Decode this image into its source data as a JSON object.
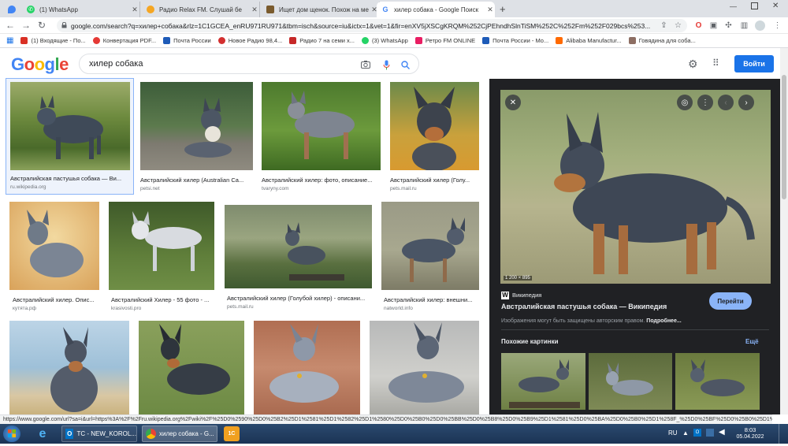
{
  "colors": {
    "accent": "#1a73e8",
    "panel_bg": "#202124",
    "link_blue": "#8ab4f8"
  },
  "tabs": [
    {
      "label": "",
      "icon": "maps-pin-icon",
      "color": "#4285f4"
    },
    {
      "label": "(1) WhatsApp",
      "icon": "whatsapp-icon",
      "color": "#25d366"
    },
    {
      "label": "Радио Relax FM. Слушай бе",
      "icon": "radio-icon",
      "color": "#f5a623"
    },
    {
      "label": "Ищет дом щенок. Похож на ме",
      "icon": "dog-icon",
      "color": "#7a5b2e"
    },
    {
      "label": "хилер собака - Google Поиск",
      "icon": "google-icon",
      "color": "#4285f4"
    }
  ],
  "toolbar": {
    "url": "google.com/search?q=хилер+собака&rlz=1C1GCEA_enRU971RU971&tbm=isch&source=iu&ictx=1&vet=1&fir=enXV5jXSCgKRQM%252CjPEhndhSlnTiSM%252C%252Fm%252F029bcs%253..."
  },
  "bookmarks": [
    {
      "label": "(1) Входящие - По...",
      "color": "#d93025"
    },
    {
      "label": "Конвертация PDF...",
      "color": "#e53935"
    },
    {
      "label": "Почта России",
      "color": "#1e5bb8"
    },
    {
      "label": "Новое Радио 98,4...",
      "color": "#d32f2f"
    },
    {
      "label": "Радио 7 на семи х...",
      "color": "#c62828"
    },
    {
      "label": "(3) WhatsApp",
      "color": "#25d366"
    },
    {
      "label": "Ретро FM ONLINE",
      "color": "#e91e63"
    },
    {
      "label": "Почта России - Мо...",
      "color": "#1e5bb8"
    },
    {
      "label": "Alibaba Manufactur...",
      "color": "#ff6a00"
    },
    {
      "label": "Говядина для соба...",
      "color": "#8d6e63"
    }
  ],
  "google": {
    "logo": "Google",
    "query": "хилер собака",
    "signin": "Войти"
  },
  "results": [
    {
      "title": "Австралийская пастушья собака — Ви...",
      "source": "ru.wikipedia.org"
    },
    {
      "title": "Австралийский хилер (Australian Ca...",
      "source": "petsi.net"
    },
    {
      "title": "Австралийский хилер: фото, описание...",
      "source": "tvaryny.com"
    },
    {
      "title": "Австралийский хилер (Голу...",
      "source": "pets.mail.ru"
    },
    {
      "title": "Австралийский хилер. Опис...",
      "source": "кутята.рф"
    },
    {
      "title": "Австралийский Хилер - 55 фото - ...",
      "source": "krasivosti.pro"
    },
    {
      "title": "Австралийский хилер (Голубой хилер) - описани...",
      "source": "pets.mail.ru"
    },
    {
      "title": "Австралийский хилер: внешни...",
      "source": "natworld.info"
    },
    {
      "title": "",
      "source": ""
    },
    {
      "title": "",
      "source": ""
    },
    {
      "title": "",
      "source": ""
    },
    {
      "title": "",
      "source": ""
    }
  ],
  "panel": {
    "dimensions": "1 200 × 895",
    "site": "Википедия",
    "title": "Австралийская пастушья собака — Википедия",
    "visit": "Перейти",
    "copyright": "Изображения могут быть защищены авторским правом.",
    "more": "Подробнее...",
    "related": "Похожие картинки",
    "more_related": "Ещё"
  },
  "status_url": "https://www.google.com/url?sa=i&url=https%3A%2F%2Fru.wikipedia.org%2Fwiki%2F%25D0%2590%25D0%25B2%25D1%2581%25D1%2582%25D1%2580%25D0%25B0%25D0%25BB%25D0%25B8%25D0%25B9%25D1%2581%25D0%25BA%25D0%25B0%25D1%258F_%25D0%25BF%25D0%25B0%25D1%2581...",
  "taskbar": {
    "outlook": "ТС - NEW_KOROL...",
    "chrome": "хилер собака - G...",
    "lang": "RU",
    "time": "8:03",
    "date": "05.04.2022"
  }
}
